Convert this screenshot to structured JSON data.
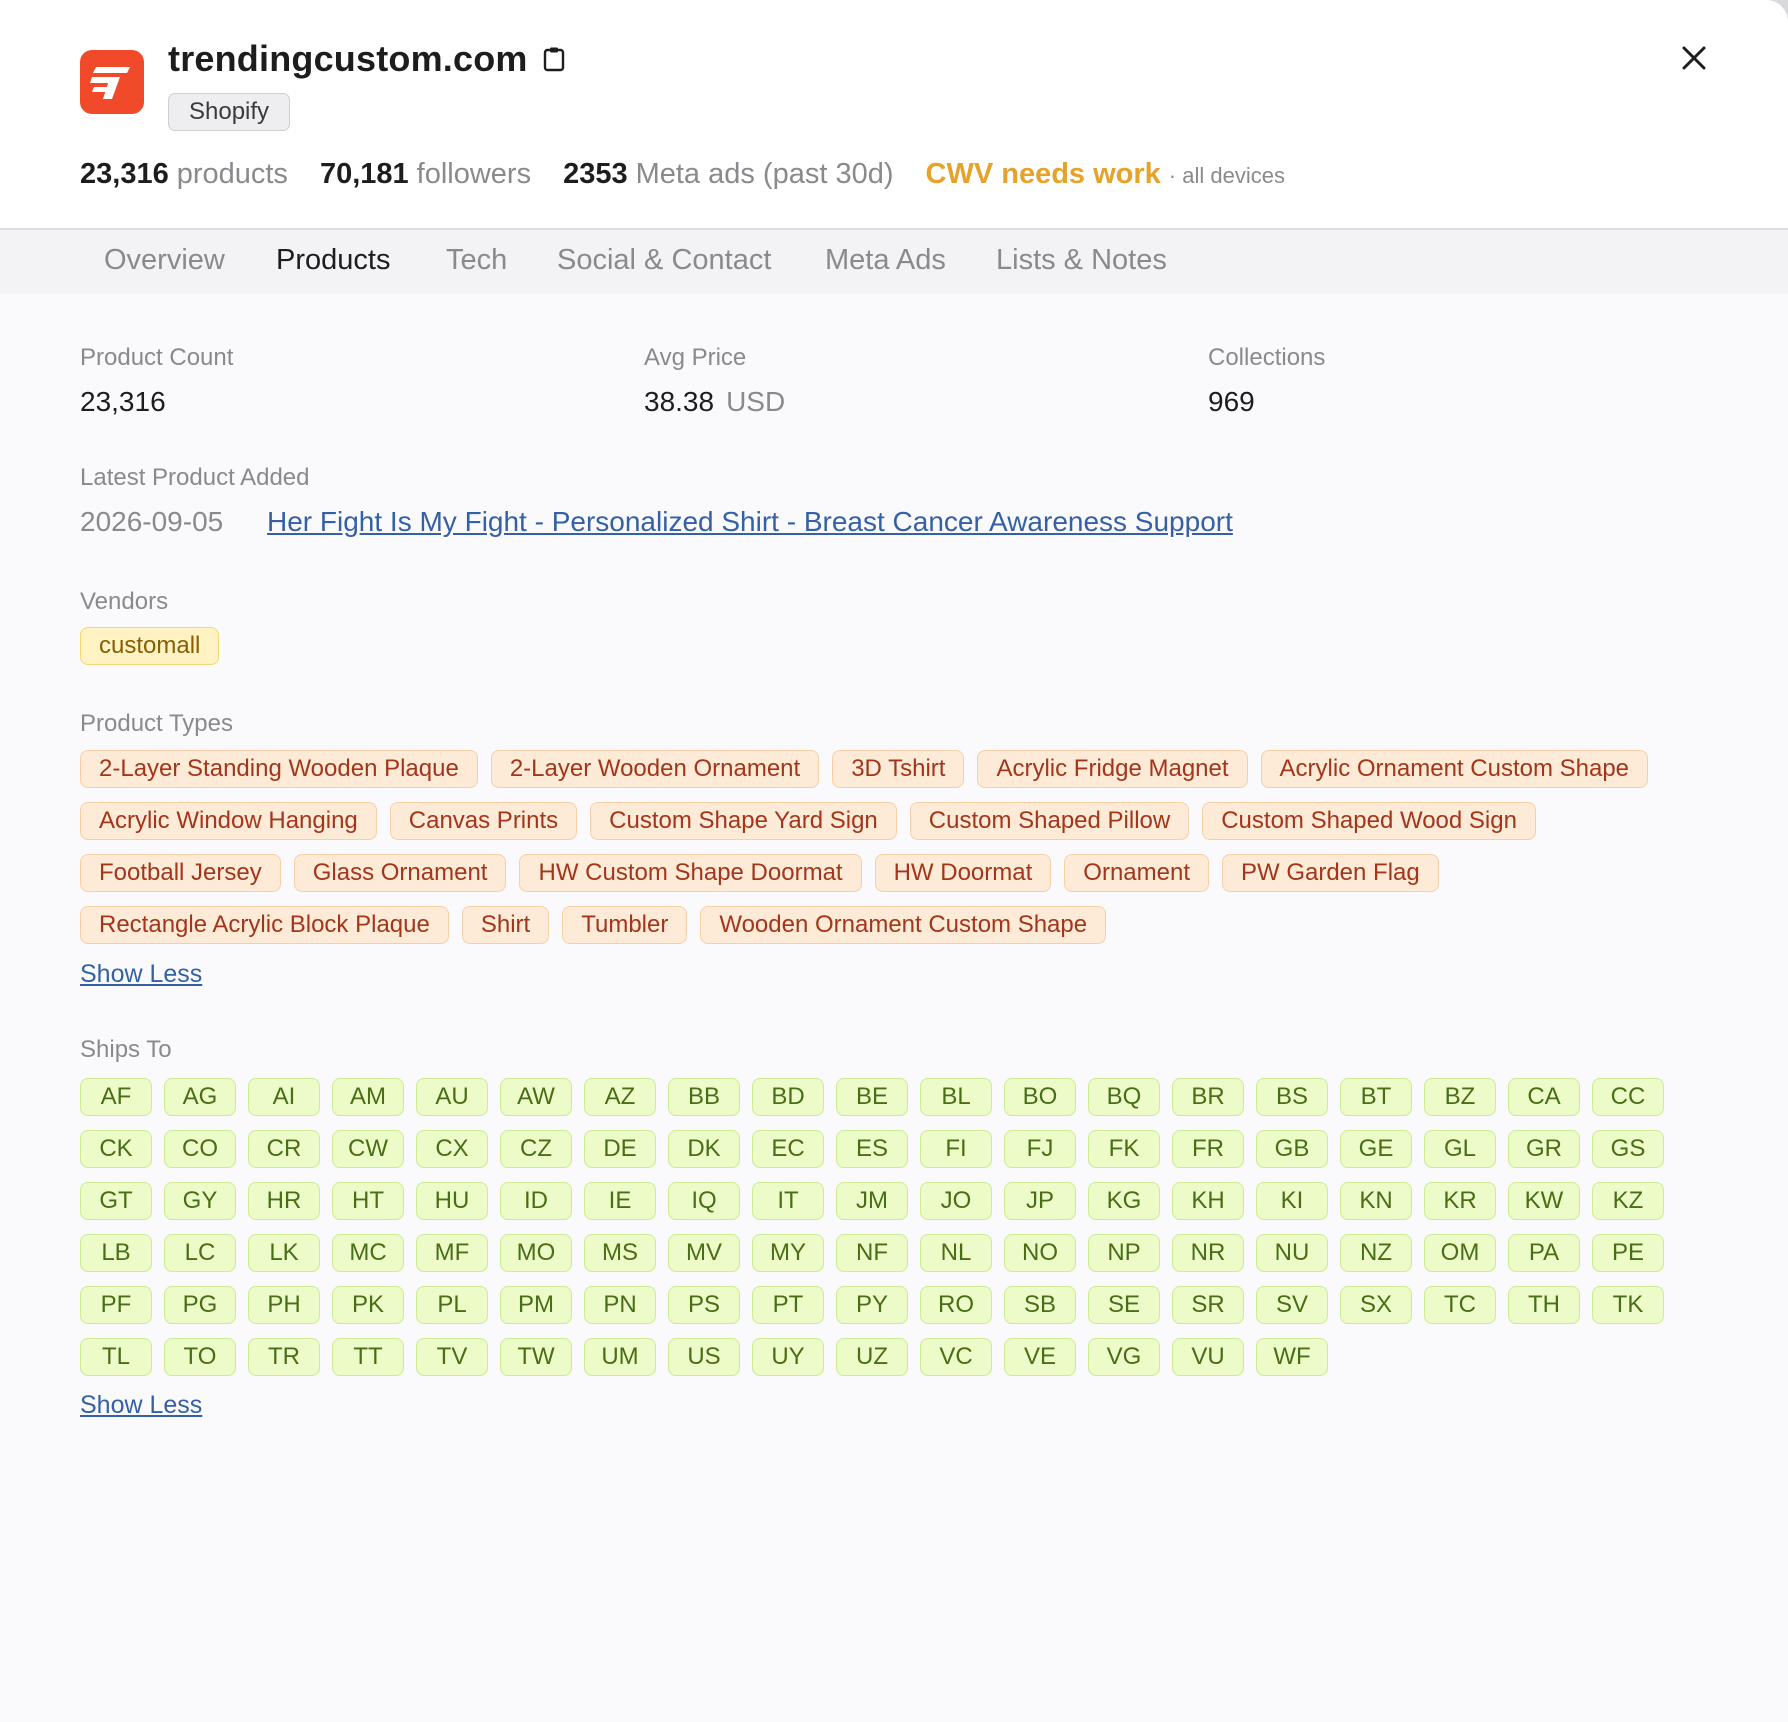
{
  "site": {
    "domain": "trendingcustom.com",
    "platform": "Shopify"
  },
  "stats": {
    "products_value": "23,316",
    "products_label": "products",
    "followers_value": "70,181",
    "followers_label": "followers",
    "ads_value": "2353",
    "ads_label": "Meta ads (past 30d)",
    "cwv_status": "CWV needs work",
    "cwv_scope": "· all devices"
  },
  "tabs": [
    "Overview",
    "Products",
    "Tech",
    "Social & Contact",
    "Meta Ads",
    "Lists & Notes"
  ],
  "active_tab": "Products",
  "summary": {
    "product_count_label": "Product Count",
    "product_count": "23,316",
    "avg_price_label": "Avg Price",
    "avg_price": "38.38",
    "currency": "USD",
    "collections_label": "Collections",
    "collections": "969"
  },
  "latest": {
    "label": "Latest Product Added",
    "date": "2026-09-05",
    "title": "Her Fight Is My Fight - Personalized Shirt - Breast Cancer Awareness Support"
  },
  "vendors": {
    "label": "Vendors",
    "items": [
      "customall"
    ]
  },
  "product_types": {
    "label": "Product Types",
    "items": [
      "2-Layer Standing Wooden Plaque",
      "2-Layer Wooden Ornament",
      "3D Tshirt",
      "Acrylic Fridge Magnet",
      "Acrylic Ornament Custom Shape",
      "Acrylic Window Hanging",
      "Canvas Prints",
      "Custom Shape Yard Sign",
      "Custom Shaped Pillow",
      "Custom Shaped Wood Sign",
      "Football Jersey",
      "Glass Ornament",
      "HW Custom Shape Doormat",
      "HW Doormat",
      "Ornament",
      "PW Garden Flag",
      "Rectangle Acrylic Block Plaque",
      "Shirt",
      "Tumbler",
      "Wooden Ornament Custom Shape"
    ],
    "toggle": "Show Less"
  },
  "ships_to": {
    "label": "Ships To",
    "items": [
      "AF",
      "AG",
      "AI",
      "AM",
      "AU",
      "AW",
      "AZ",
      "BB",
      "BD",
      "BE",
      "BL",
      "BO",
      "BQ",
      "BR",
      "BS",
      "BT",
      "BZ",
      "CA",
      "CC",
      "CK",
      "CO",
      "CR",
      "CW",
      "CX",
      "CZ",
      "DE",
      "DK",
      "EC",
      "ES",
      "FI",
      "FJ",
      "FK",
      "FR",
      "GB",
      "GE",
      "GL",
      "GR",
      "GS",
      "GT",
      "GY",
      "HR",
      "HT",
      "HU",
      "ID",
      "IE",
      "IQ",
      "IT",
      "JM",
      "JO",
      "JP",
      "KG",
      "KH",
      "KI",
      "KN",
      "KR",
      "KW",
      "KZ",
      "LB",
      "LC",
      "LK",
      "MC",
      "MF",
      "MO",
      "MS",
      "MV",
      "MY",
      "NF",
      "NL",
      "NO",
      "NP",
      "NR",
      "NU",
      "NZ",
      "OM",
      "PA",
      "PE",
      "PF",
      "PG",
      "PH",
      "PK",
      "PL",
      "PM",
      "PN",
      "PS",
      "PT",
      "PY",
      "RO",
      "SB",
      "SE",
      "SR",
      "SV",
      "SX",
      "TC",
      "TH",
      "TK",
      "TL",
      "TO",
      "TR",
      "TT",
      "TV",
      "TW",
      "UM",
      "US",
      "UY",
      "UZ",
      "VC",
      "VE",
      "VG",
      "VU",
      "WF"
    ],
    "toggle": "Show Less"
  },
  "colors": {
    "brand": "#f04a2a",
    "cwv_warning": "#e6a22b",
    "link": "#3461a5"
  },
  "icons": {
    "logo": "trendingcustom-logo",
    "copy": "clipboard-icon",
    "close": "close-icon"
  }
}
